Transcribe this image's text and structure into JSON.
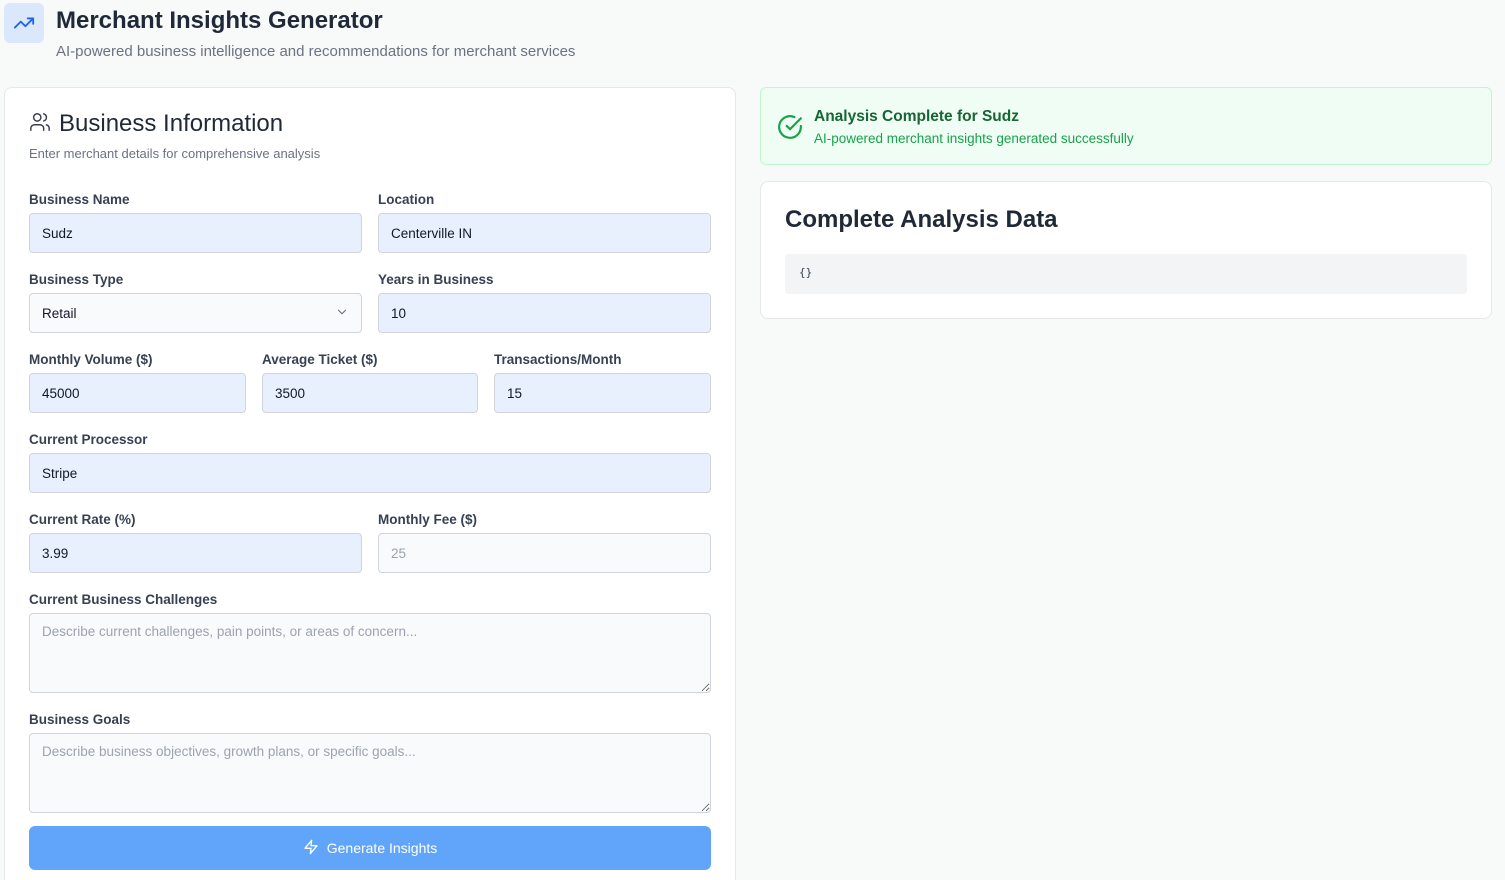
{
  "header": {
    "title": "Merchant Insights Generator",
    "subtitle": "AI-powered business intelligence and recommendations for merchant services",
    "logo_icon": "trending-up-icon"
  },
  "form": {
    "title": "Business Information",
    "description": "Enter merchant details for comprehensive analysis",
    "business_name": {
      "label": "Business Name",
      "value": "Sudz"
    },
    "location": {
      "label": "Location",
      "value": "Centerville IN"
    },
    "business_type": {
      "label": "Business Type",
      "value": "Retail"
    },
    "years_in_business": {
      "label": "Years in Business",
      "value": "10"
    },
    "monthly_volume": {
      "label": "Monthly Volume ($)",
      "value": "45000"
    },
    "average_ticket": {
      "label": "Average Ticket ($)",
      "value": "3500"
    },
    "transactions_month": {
      "label": "Transactions/Month",
      "value": "15"
    },
    "current_processor": {
      "label": "Current Processor",
      "value": "Stripe"
    },
    "current_rate": {
      "label": "Current Rate (%)",
      "value": "3.99"
    },
    "monthly_fee": {
      "label": "Monthly Fee ($)",
      "value": "",
      "placeholder": "25"
    },
    "challenges": {
      "label": "Current Business Challenges",
      "value": "",
      "placeholder": "Describe current challenges, pain points, or areas of concern..."
    },
    "goals": {
      "label": "Business Goals",
      "value": "",
      "placeholder": "Describe business objectives, growth plans, or specific goals..."
    },
    "submit_label": "Generate Insights"
  },
  "status": {
    "title": "Analysis Complete for Sudz",
    "description": "AI-powered merchant insights generated successfully"
  },
  "analysis": {
    "title": "Complete Analysis Data",
    "json": "{}"
  },
  "colors": {
    "accent": "#60a5fa",
    "success_bg": "#f0fdf4",
    "success_text": "#166534",
    "autofill_bg": "#e8f0fe"
  }
}
